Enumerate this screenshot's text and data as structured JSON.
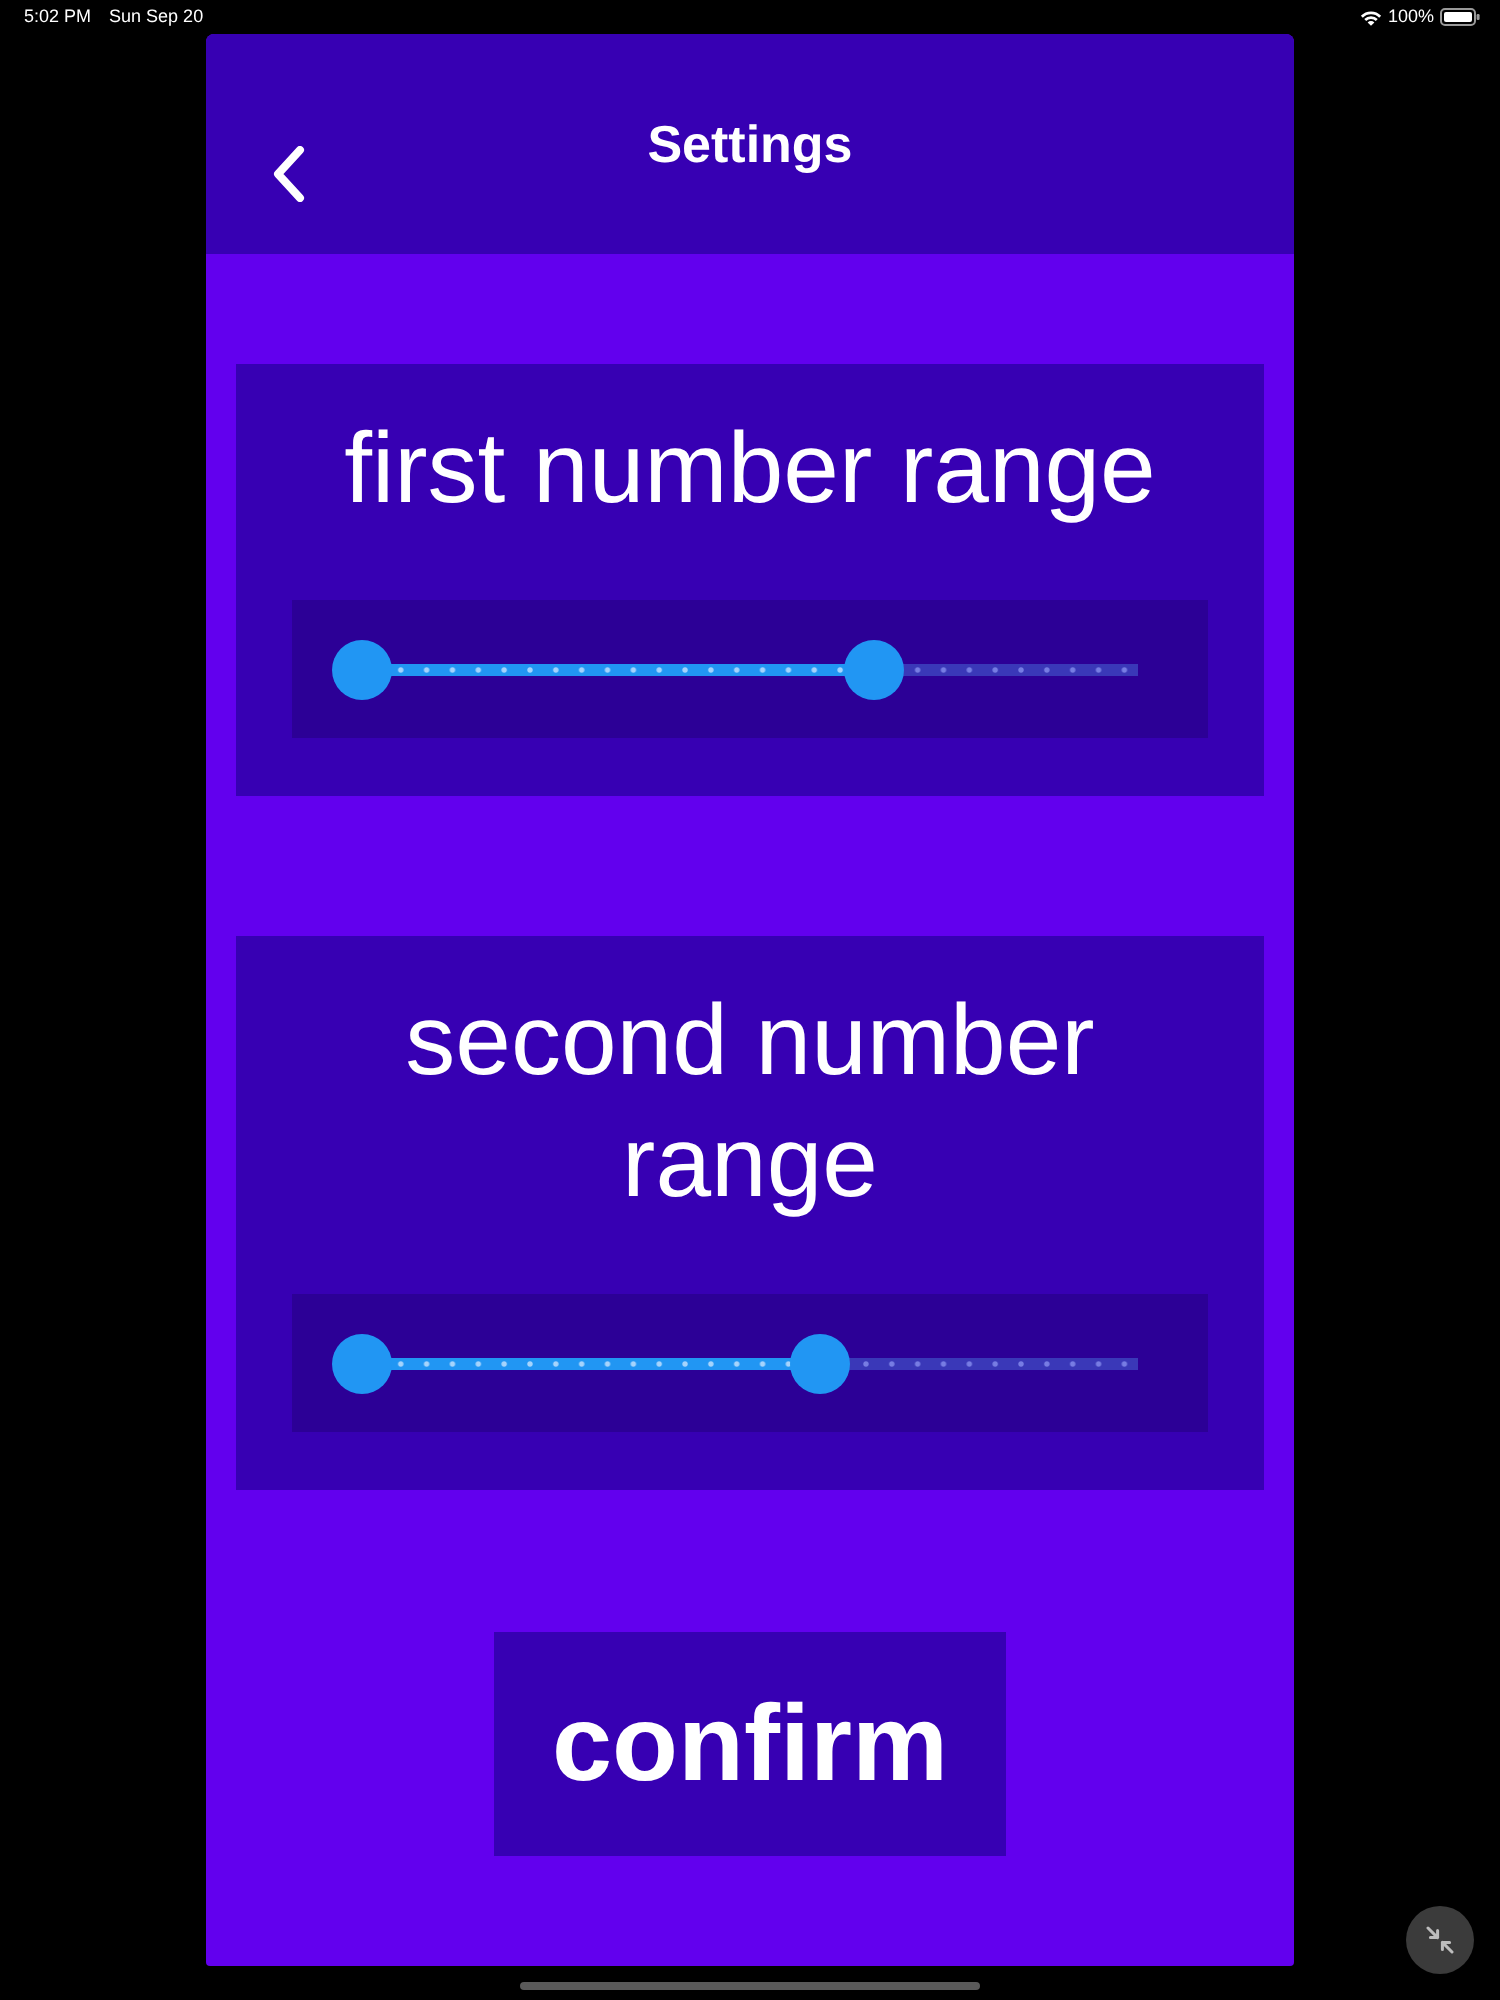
{
  "status_bar": {
    "time": "5:02 PM",
    "date": "Sun Sep 20",
    "battery": "100%"
  },
  "header": {
    "title": "Settings"
  },
  "ranges": [
    {
      "label": "first number range",
      "thumbs": [
        {
          "level": 0
        },
        {
          "level": 0.66
        }
      ]
    },
    {
      "label": "second number range",
      "thumbs": [
        {
          "level": 0
        },
        {
          "level": 0.59
        }
      ]
    }
  ],
  "confirm_button": {
    "label": "confirm"
  }
}
